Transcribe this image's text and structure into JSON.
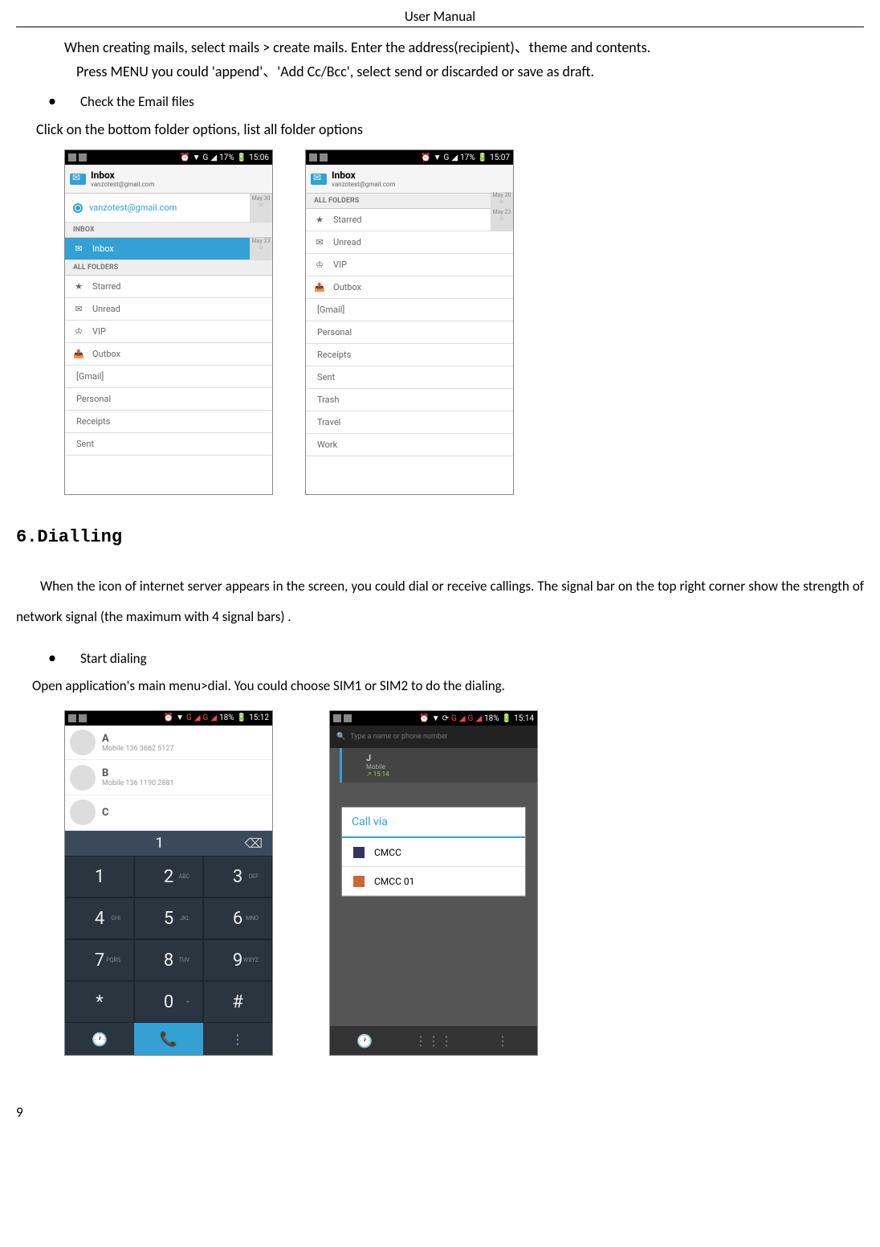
{
  "header": {
    "title": "User Manual"
  },
  "intro": {
    "line1": "When creating mails, select mails > create mails. Enter the address(recipient)、theme and contents.",
    "line2": "Press MENU you could 'append'、'Add Cc/Bcc',  select send or discarded or save as draft."
  },
  "bullet_check": "Check the Email files",
  "check_sub": "Click on the bottom folder options, list all folder options",
  "email_screen_left": {
    "status": {
      "signal": "17%",
      "time": "15:06",
      "gicon": "G"
    },
    "inbox_title": "Inbox",
    "account": "vanzotest@gmail.com",
    "selected_account": "vanzotest@gmail.com",
    "label_inbox": "INBOX",
    "label_all": "ALL FOLDERS",
    "folders": [
      "Inbox",
      "Starred",
      "Unread",
      "VIP",
      "Outbox",
      "[Gmail]",
      "Personal",
      "Receipts",
      "Sent"
    ],
    "dates": [
      "May 30",
      "May 23"
    ]
  },
  "email_screen_right": {
    "status": {
      "signal": "17%",
      "time": "15:07",
      "gicon": "G"
    },
    "inbox_title": "Inbox",
    "account": "vanzotest@gmail.com",
    "label_all": "ALL FOLDERS",
    "folders": [
      "Starred",
      "Unread",
      "VIP",
      "Outbox",
      "[Gmail]",
      "Personal",
      "Receipts",
      "Sent",
      "Trash",
      "Travel",
      "Work"
    ],
    "dates": [
      "May 30",
      "May 23"
    ]
  },
  "section6": {
    "heading": "6.Dialling",
    "para": "When the icon of internet server appears in the screen, you could dial or receive callings. The signal bar on the top right corner show the strength of network signal (the maximum with 4 signal bars) .",
    "bullet": "Start dialing",
    "sub": "Open application's main menu>dial. You could choose SIM1 or SIM2 to do the dialing."
  },
  "dial_screen_left": {
    "status": {
      "signal": "18%",
      "time": "15:12",
      "gicon": "G"
    },
    "contacts": [
      {
        "name": "A",
        "num": "Mobile 136 3662 5127"
      },
      {
        "name": "B",
        "num": "Mobile 136 1190 2881"
      },
      {
        "name": "C",
        "num": ""
      }
    ],
    "dialed": "1",
    "keys": [
      {
        "n": "1",
        "s": ""
      },
      {
        "n": "2",
        "s": "ABC"
      },
      {
        "n": "3",
        "s": "DEF"
      },
      {
        "n": "4",
        "s": "GHI"
      },
      {
        "n": "5",
        "s": "JKL"
      },
      {
        "n": "6",
        "s": "MNO"
      },
      {
        "n": "7",
        "s": "PQRS"
      },
      {
        "n": "8",
        "s": "TUV"
      },
      {
        "n": "9",
        "s": "WXYZ"
      },
      {
        "n": "*",
        "s": ""
      },
      {
        "n": "0",
        "s": "+"
      },
      {
        "n": "#",
        "s": ""
      }
    ]
  },
  "dial_screen_right": {
    "status": {
      "signal": "18%",
      "time": "15:14",
      "gicon": "G"
    },
    "search_placeholder": "Type a name or phone number",
    "recent": {
      "name": "J",
      "detail": "Mobile",
      "time": "15:14"
    },
    "dialog_title": "Call via",
    "options": [
      "CMCC",
      "CMCC 01"
    ]
  },
  "page_number": "9"
}
